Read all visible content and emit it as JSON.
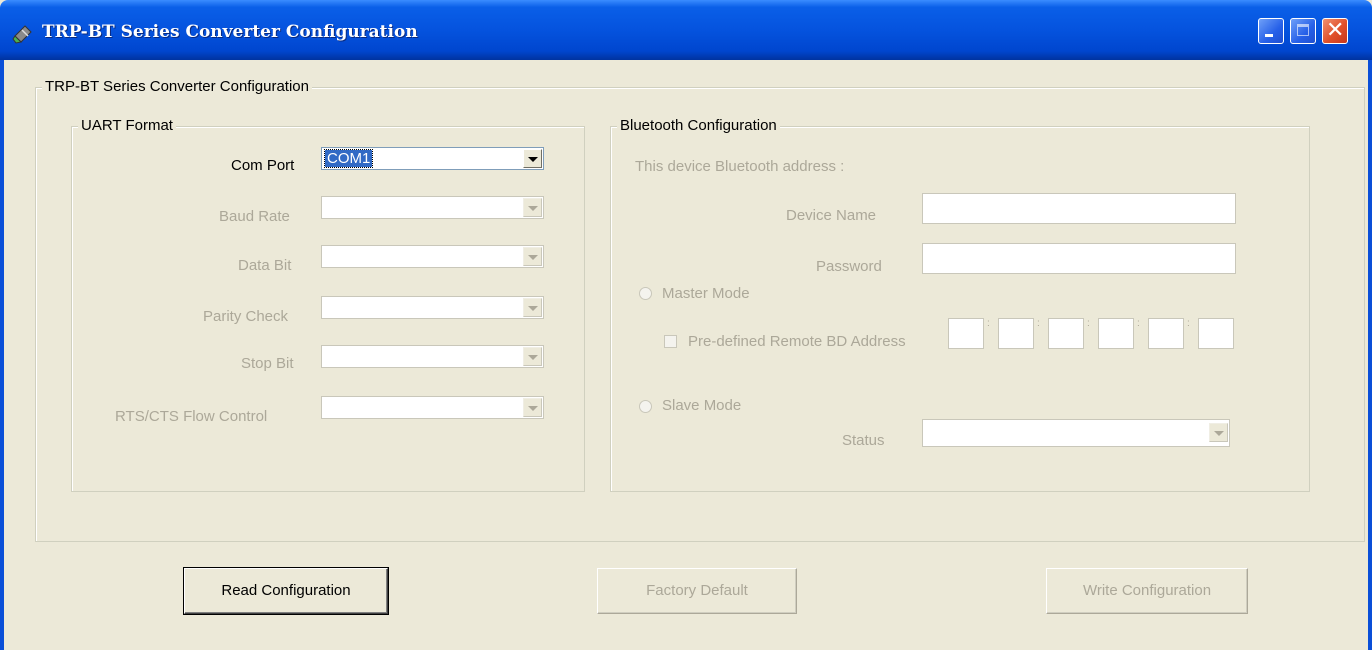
{
  "window": {
    "title": "TRP-BT Series Converter Configuration"
  },
  "main_group": {
    "legend": "TRP-BT Series Converter Configuration"
  },
  "uart": {
    "legend": "UART Format",
    "com_port": {
      "label": "Com Port",
      "value": "COM1"
    },
    "baud_rate": {
      "label": "Baud Rate",
      "value": ""
    },
    "data_bit": {
      "label": "Data Bit",
      "value": ""
    },
    "parity_check": {
      "label": "Parity Check",
      "value": ""
    },
    "stop_bit": {
      "label": "Stop Bit",
      "value": ""
    },
    "rts_cts": {
      "label": "RTS/CTS Flow Control",
      "value": ""
    }
  },
  "bluetooth": {
    "legend": "Bluetooth Configuration",
    "address_label": "This device Bluetooth address :",
    "device_name_label": "Device Name",
    "password_label": "Password",
    "master_mode_label": "Master Mode",
    "predefined_label": "Pre-defined Remote BD Address",
    "slave_mode_label": "Slave Mode",
    "status_label": "Status"
  },
  "buttons": {
    "read": "Read Configuration",
    "factory": "Factory Default",
    "write": "Write Configuration"
  },
  "colors": {
    "titlebar": "#0553DE",
    "window_bg": "#ECE9D8",
    "selection": "#316AC5",
    "disabled_text": "#ACA899"
  },
  "icons": [
    "app-icon",
    "minimize-icon",
    "maximize-icon",
    "close-icon",
    "dropdown-arrow-icon"
  ]
}
